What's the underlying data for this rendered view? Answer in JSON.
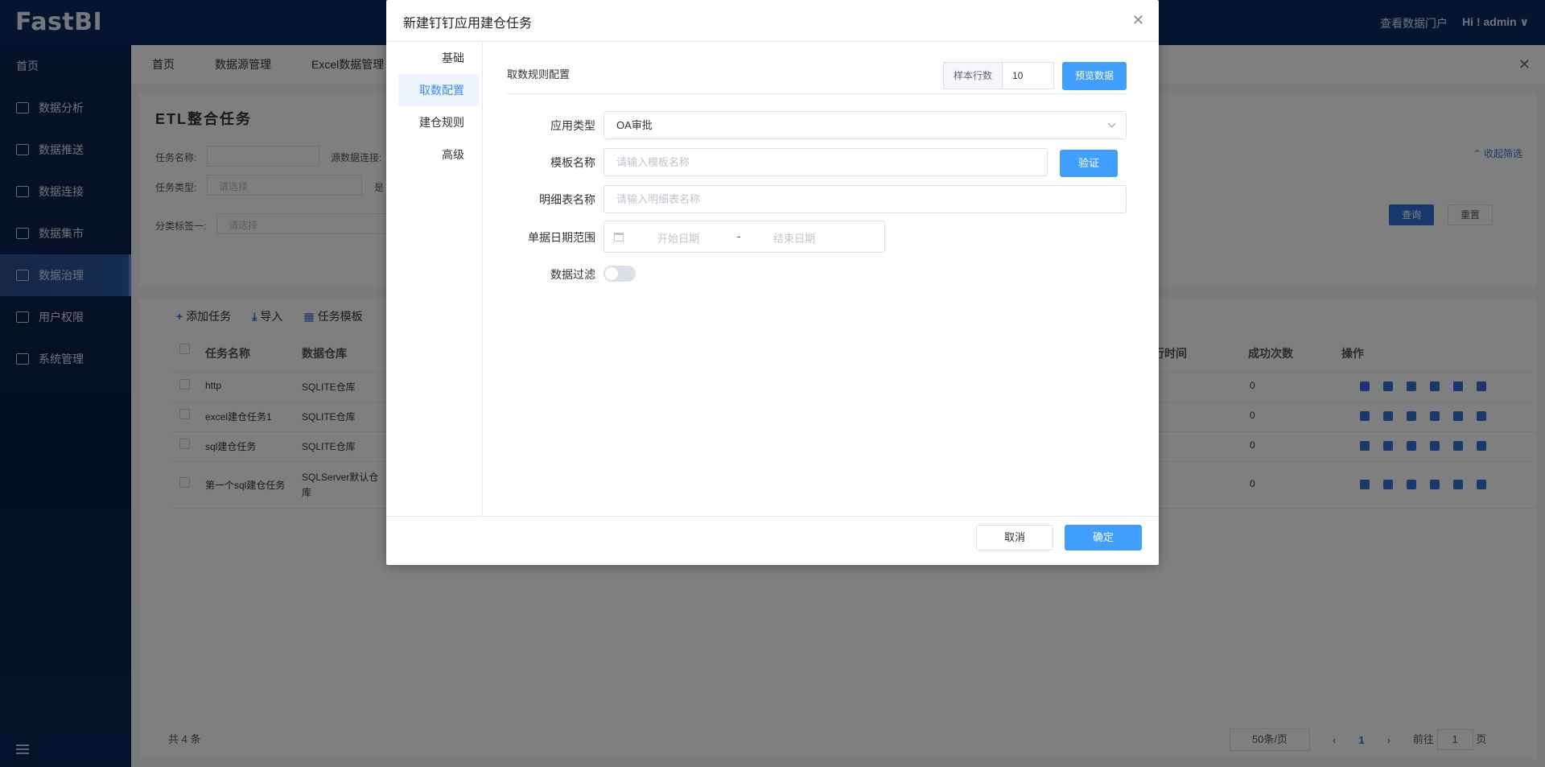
{
  "app": {
    "logo": "FastBI",
    "portal_link": "查看数据门户",
    "user": "Hi ! admin ∨"
  },
  "sidebar": {
    "home": "首页",
    "items": [
      {
        "label": "数据分析",
        "icon": "chart-icon"
      },
      {
        "label": "数据推送",
        "icon": "push-icon"
      },
      {
        "label": "数据连接",
        "icon": "connect-icon"
      },
      {
        "label": "数据集市",
        "icon": "market-icon"
      },
      {
        "label": "数据治理",
        "icon": "governance-icon",
        "active": true
      },
      {
        "label": "用户权限",
        "icon": "user-icon"
      },
      {
        "label": "系统管理",
        "icon": "system-icon"
      }
    ]
  },
  "tabs": [
    "首页",
    "数据源管理",
    "Excel数据管理"
  ],
  "page": {
    "title": "ETL整合任务",
    "collapse": "收起筛选",
    "filters": {
      "task_name_label": "任务名称:",
      "source_label": "源数据连接:",
      "type_label": "任务类型:",
      "type_placeholder": "请选择",
      "shi_label": "是",
      "tag_label": "分类标签一:",
      "tag_placeholder": "请选择"
    },
    "query_btn": "查询",
    "reset_btn": "重置"
  },
  "table": {
    "toolbar": {
      "add": "添加任务",
      "import": "导入",
      "template": "任务模板"
    },
    "headers": {
      "name": "任务名称",
      "warehouse": "数据仓库",
      "exec_time": "行时间",
      "success": "成功次数",
      "ops": "操作"
    },
    "rows": [
      {
        "name": "http",
        "warehouse": "SQLITE仓库",
        "success": "0"
      },
      {
        "name": "excel建仓任务1",
        "warehouse": "SQLITE仓库",
        "success": "0"
      },
      {
        "name": "sql建仓任务",
        "warehouse": "SQLITE仓库",
        "success": "0"
      },
      {
        "name": "第一个sql建仓任务",
        "warehouse": "SQLServer默认仓\n库",
        "success": "0"
      }
    ],
    "total": "共 4 条",
    "page_size": "50条/页",
    "current_page": "1",
    "goto_label": "前往",
    "goto_value": "1",
    "page_suffix": "页"
  },
  "dialog": {
    "title": "新建钉钉应用建仓任务",
    "nav": [
      "基础",
      "取数配置",
      "建仓规则",
      "高级"
    ],
    "active_nav": "取数配置",
    "section_title": "取数规则配置",
    "sample_label": "样本行数",
    "sample_value": "10",
    "preview_btn": "预览数据",
    "fields": {
      "app_type_label": "应用类型",
      "app_type_value": "OA审批",
      "template_label": "模板名称",
      "template_placeholder": "请输入模板名称",
      "verify_btn": "验证",
      "detail_label": "明细表名称",
      "detail_placeholder": "请输入明细表名称",
      "date_label": "单据日期范围",
      "date_start": "开始日期",
      "date_sep": "-",
      "date_end": "结束日期",
      "filter_label": "数据过滤"
    },
    "cancel_btn": "取消",
    "ok_btn": "确定"
  }
}
